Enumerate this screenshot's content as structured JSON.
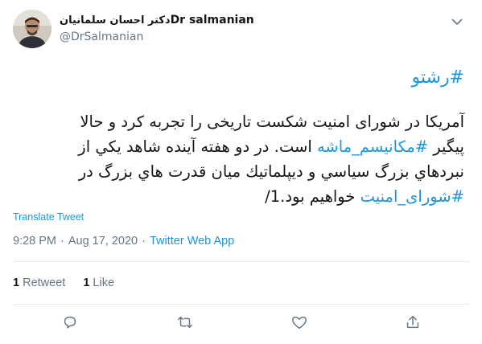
{
  "author": {
    "name_fa": "دکتر احسان سلمانیان",
    "name_en": "Dr salmanian",
    "handle": "@DrSalmanian"
  },
  "tweet": {
    "hashtag_line": "#رشتو",
    "lines": [
      {
        "before": "",
        "tag": "",
        "after": "آمریکا در شورای امنیت شکست تاریخی را تجربه کرد و حالا"
      },
      {
        "before": "پیگیر ",
        "tag": "#مکانیسم_ماشه",
        "after": " است. در دو هفته آینده شاهد یکي از"
      },
      {
        "before": "",
        "tag": "",
        "after": "نبردهاي بزرگ سیاسي و دیپلماتیك میان قدرت هاي بزرگ در"
      },
      {
        "before": "",
        "tag": "#شورای_امنیت",
        "after": " خواهیم بود.1/"
      }
    ],
    "translate_label": "Translate Tweet",
    "time": "9:28 PM",
    "date": "Aug 17, 2020",
    "separator": "·",
    "source": "Twitter Web App"
  },
  "stats": {
    "retweets_count": "1",
    "retweets_label": "Retweet",
    "likes_count": "1",
    "likes_label": "Like"
  },
  "icons": {
    "reply": "reply-icon",
    "retweet": "retweet-icon",
    "like": "like-icon",
    "share": "share-icon",
    "more": "chevron-down-icon"
  },
  "colors": {
    "accent": "#1b95e0",
    "text": "#14171a",
    "muted": "#657786",
    "divider": "#e6ecf0"
  }
}
